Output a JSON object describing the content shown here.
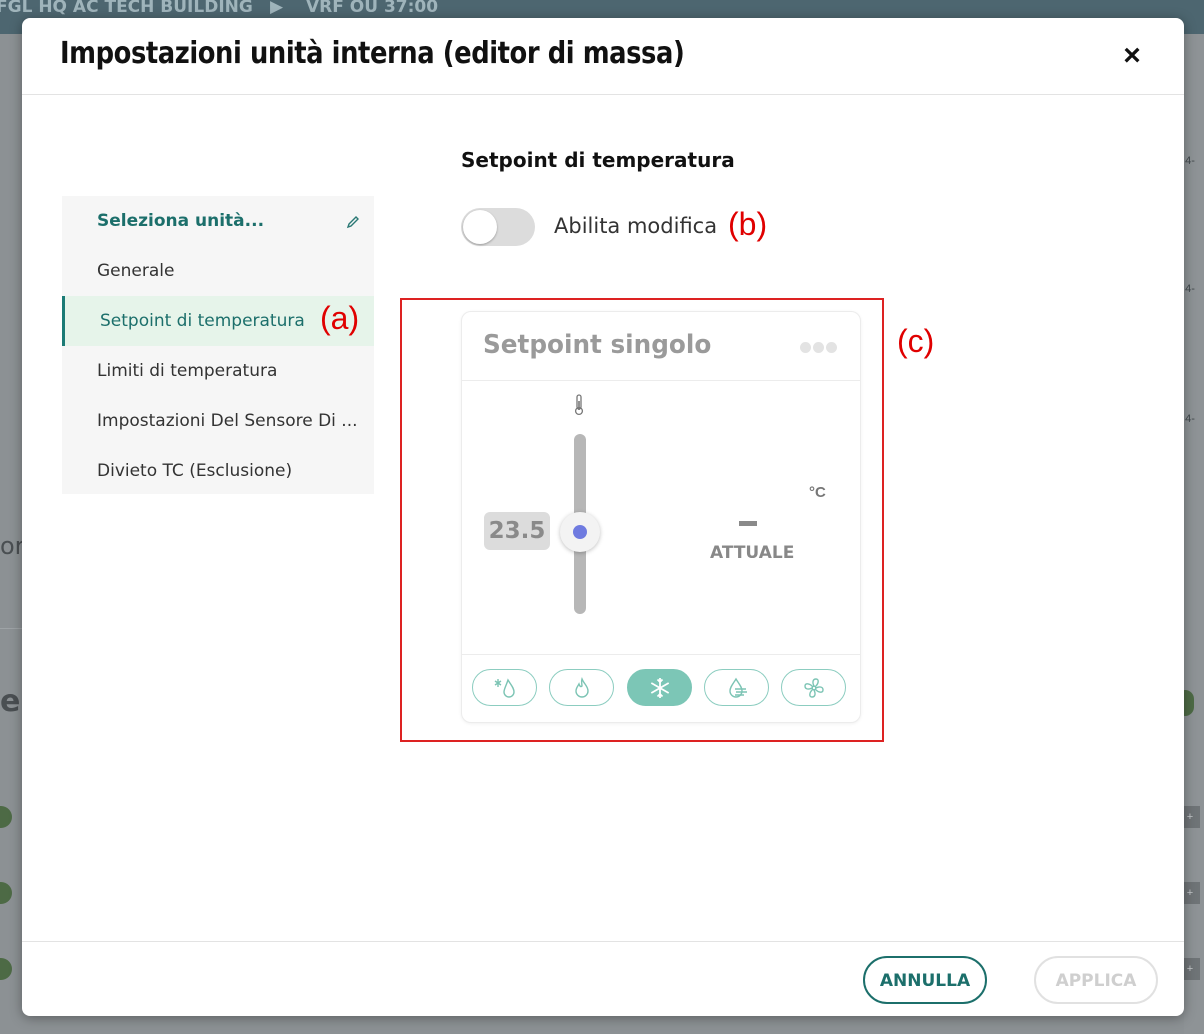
{
  "background": {
    "topbar_left": "FGL HQ AC TECH BUILDING",
    "topbar_arrow": "▶",
    "topbar_right": "VRF OU 37:00",
    "frag_or": "or",
    "frag_er": "er",
    "tag_4a": "4-",
    "tag_4b": "4-",
    "tag_4c": "4-",
    "tag_plus": "+"
  },
  "modal": {
    "title": "Impostazioni unità interna (editor di massa)",
    "close": "×"
  },
  "nav": {
    "items": [
      {
        "label": "Seleziona unità..."
      },
      {
        "label": "Generale"
      },
      {
        "label": "Setpoint di temperatura"
      },
      {
        "label": "Limiti di temperatura"
      },
      {
        "label": "Impostazioni Del Sensore Di ..."
      },
      {
        "label": "Divieto TC (Esclusione)"
      }
    ]
  },
  "annotations": {
    "a": "(a)",
    "b": "(b)",
    "c": "(c)"
  },
  "section": {
    "title": "Setpoint di temperatura",
    "toggle_label": "Abilita modifica",
    "toggle_on": false
  },
  "card": {
    "title": "Setpoint singolo",
    "setpoint": "23.5",
    "unit": "°C",
    "current_label": "ATTUALE",
    "modes": [
      {
        "icon": "auto-mode-icon"
      },
      {
        "icon": "heat-mode-icon"
      },
      {
        "icon": "cool-mode-icon",
        "selected": true
      },
      {
        "icon": "dry-mode-icon"
      },
      {
        "icon": "fan-mode-icon"
      }
    ]
  },
  "footer": {
    "cancel": "ANNULLA",
    "apply": "APPLICA"
  },
  "colors": {
    "accent": "#1c6f6b",
    "mode": "#7cc6b6",
    "knob": "#6f7be0",
    "annotation": "#e00000"
  }
}
